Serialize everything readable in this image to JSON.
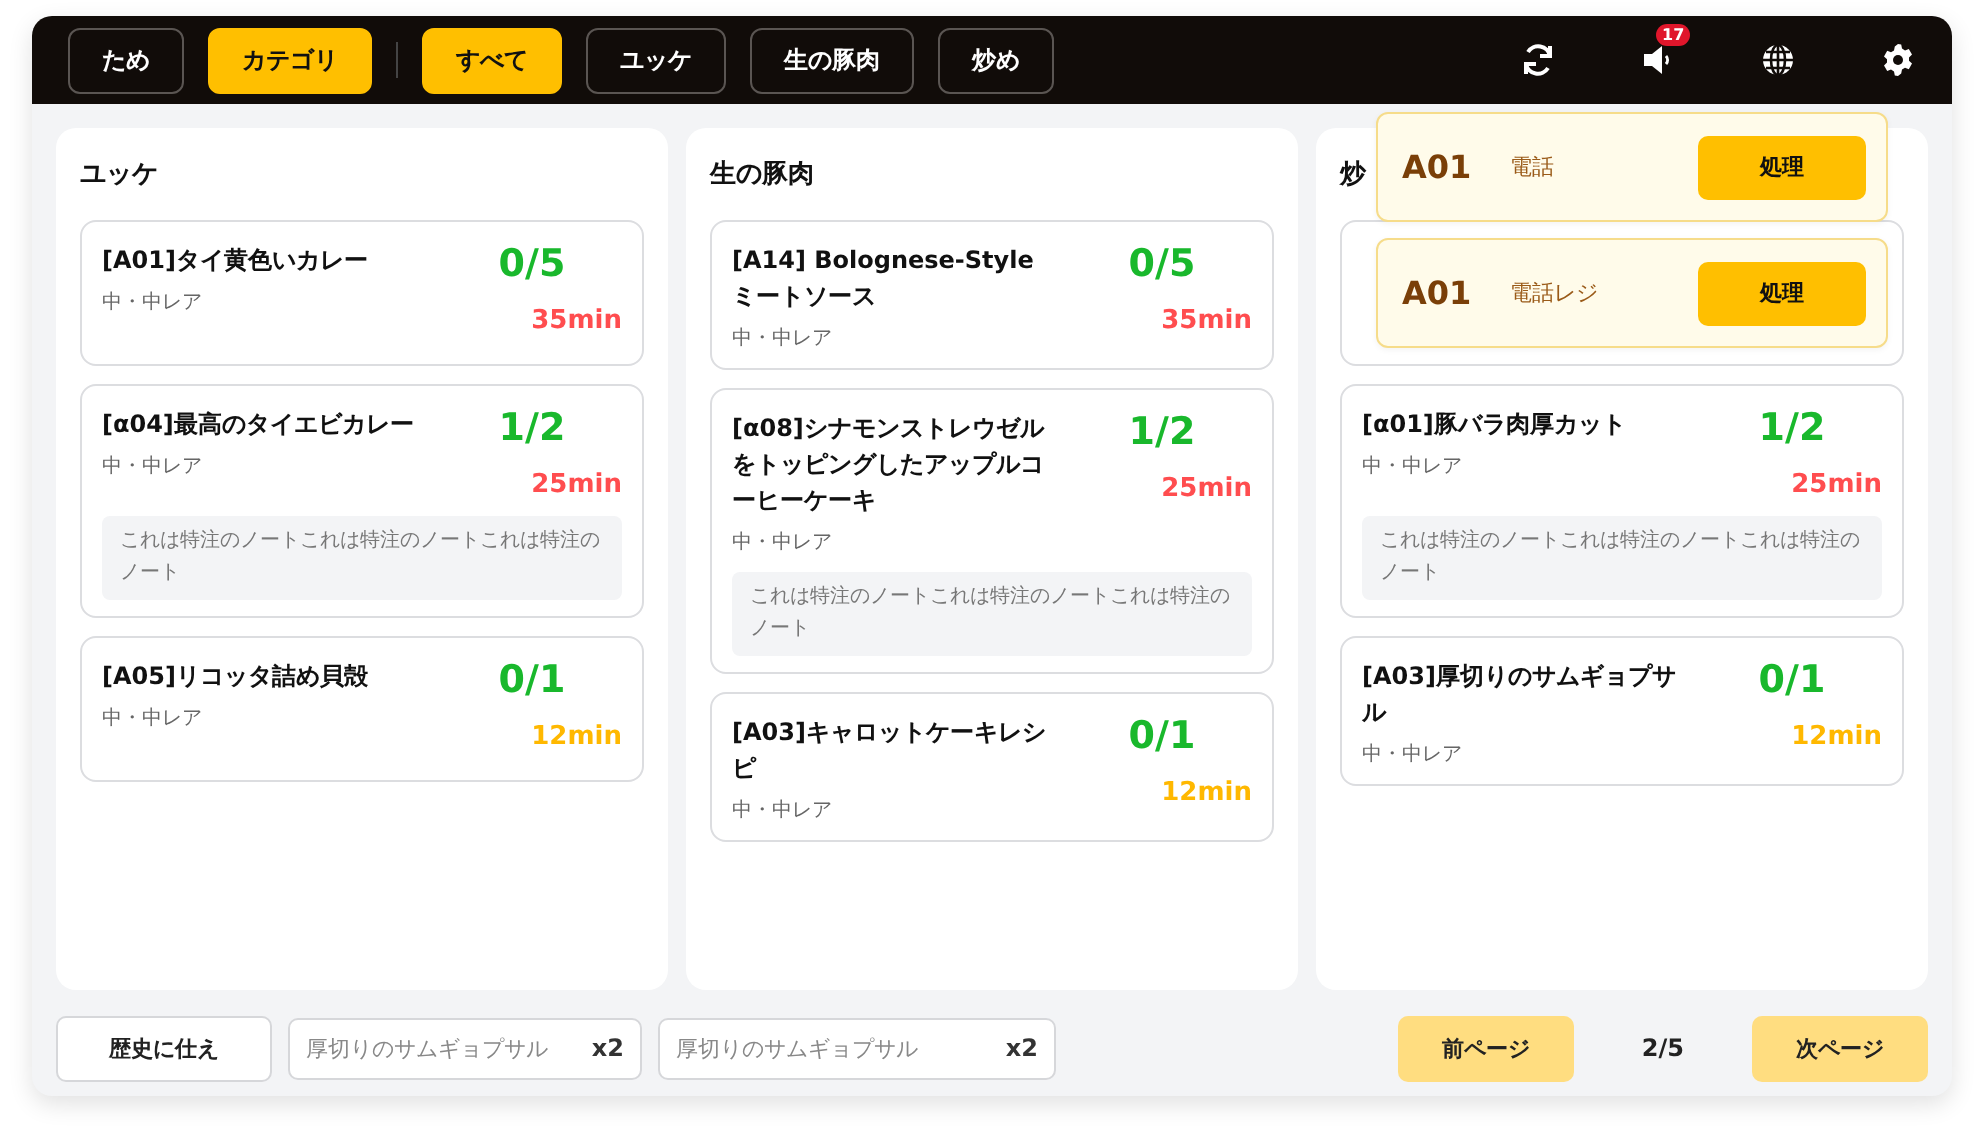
{
  "top_bar": {
    "modes": [
      {
        "label": "ため",
        "selected": false
      },
      {
        "label": "カテゴリ",
        "selected": true
      }
    ],
    "filters": [
      {
        "label": "すべて",
        "selected": true
      },
      {
        "label": "ユッケ",
        "selected": false
      },
      {
        "label": "生の豚肉",
        "selected": false
      },
      {
        "label": "炒め",
        "selected": false
      }
    ],
    "notification_count": "17"
  },
  "columns": [
    {
      "title": "ユッケ",
      "cards": [
        {
          "kind": "item",
          "title": "[A01]タイ黄色いカレー",
          "detail": "中・中レア",
          "count": "0/5",
          "time": "35min",
          "color": "#ff4d4f"
        },
        {
          "kind": "item",
          "title": "[α04]最高のタイエビカレー",
          "detail": "中・中レア",
          "count": "1/2",
          "time": "25min",
          "color": "#ff4d4f",
          "note": "これは特注のノートこれは特注のノートこれは特注のノート"
        },
        {
          "kind": "item",
          "title": "[A05]リコッタ詰め貝殻",
          "detail": "中・中レア",
          "count": "0/1",
          "time": "12min",
          "color": "#ffb800"
        }
      ]
    },
    {
      "title": "生の豚肉",
      "cards": [
        {
          "kind": "item",
          "title": "[A14] Bolognese-Styleミートソース",
          "detail": "中・中レア",
          "count": "0/5",
          "time": "35min",
          "color": "#ff4d4f"
        },
        {
          "kind": "item",
          "title": "[α08]シナモンストレウゼルをトッピングしたアップルコーヒーケーキ",
          "detail": "中・中レア",
          "count": "1/2",
          "time": "25min",
          "color": "#ff4d4f",
          "note": "これは特注のノートこれは特注のノートこれは特注のノート"
        },
        {
          "kind": "item",
          "title": "[A03]キャロットケーキレシピ",
          "detail": "中・中レア",
          "count": "0/1",
          "time": "12min",
          "color": "#ffb800"
        }
      ]
    },
    {
      "title": "炒",
      "cards": [
        {
          "kind": "covered"
        },
        {
          "kind": "item",
          "title": "[α01]豚バラ肉厚カット",
          "detail": "中・中レア",
          "count": "1/2",
          "time": "25min",
          "color": "#ff4d4f",
          "note": "これは特注のノートこれは特注のノートこれは特注のノート"
        },
        {
          "kind": "item",
          "title": "[A03]厚切りのサムギョプサル",
          "detail": "中・中レア",
          "count": "0/1",
          "time": "12min",
          "color": "#ffb800"
        }
      ]
    }
  ],
  "toasts": [
    {
      "table": "A01",
      "message": "電話",
      "action": "処理"
    },
    {
      "table": "A01",
      "message": "電話レジ",
      "action": "処理"
    }
  ],
  "footer": {
    "history_button": "歴史に仕え",
    "chips": [
      {
        "name": "厚切りのサムギョプサル",
        "quantity": "x2"
      },
      {
        "name": "厚切りのサムギョプサル",
        "quantity": "x2"
      }
    ],
    "prev_button": "前ページ",
    "page": "2/5",
    "next_button": "次ページ"
  }
}
